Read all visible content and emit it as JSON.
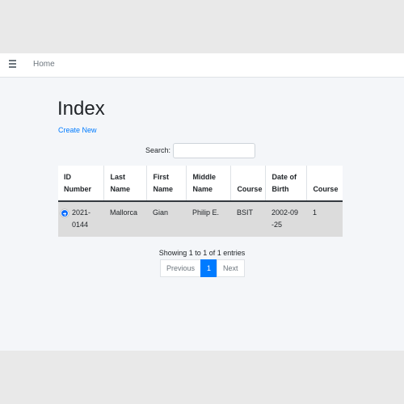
{
  "navbar": {
    "menu_icon": "hamburger-icon",
    "home_label": "Home"
  },
  "page": {
    "title": "Index",
    "create_link": "Create New"
  },
  "search": {
    "label": "Search:",
    "value": ""
  },
  "table": {
    "headers": [
      "ID\nNumber",
      "Last\nName",
      "First\nName",
      "Middle\nName",
      "Course",
      "Date of\nBirth",
      "Course"
    ],
    "rows": [
      {
        "id_number": "2021-0144",
        "last_name": "Mallorca",
        "first_name": "Gian",
        "middle_name": "Philip E.",
        "course": "BSIT",
        "date_of_birth": "2002-09-25",
        "course2": "1"
      }
    ],
    "expand_icon": "plus-circle-icon",
    "expand_color": "#0d6efd"
  },
  "info_text": "Showing 1 to 1 of 1 entries",
  "pagination": {
    "previous": "Previous",
    "current": "1",
    "next": "Next",
    "active_color": "#007bff"
  }
}
